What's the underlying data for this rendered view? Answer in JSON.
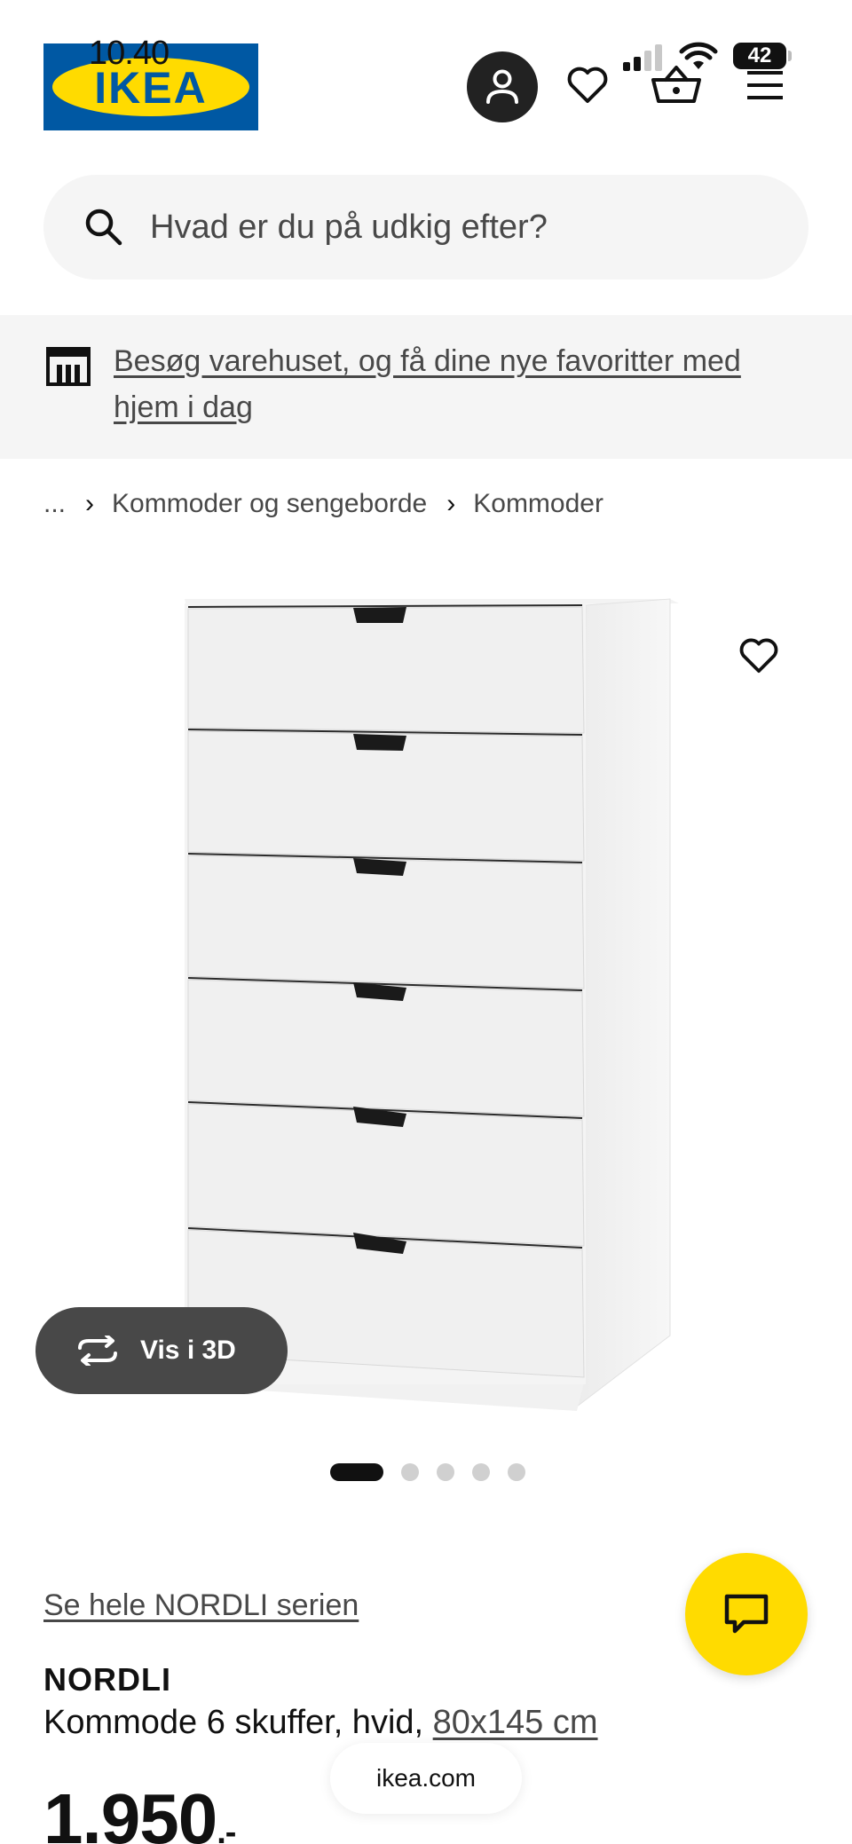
{
  "status_bar": {
    "time": "10.40",
    "battery": "42"
  },
  "header": {
    "logo_text": "IKEA"
  },
  "search": {
    "placeholder": "Hvad er du på udkig efter?"
  },
  "banner": {
    "link_text": "Besøg varehuset, og få dine nye favoritter med hjem i dag"
  },
  "breadcrumb": {
    "ellipsis": "...",
    "items": [
      "Kommoder og sengeborde",
      "Kommoder"
    ]
  },
  "gallery": {
    "view_3d_label": "Vis i 3D",
    "image_count": 5,
    "active_index": 0
  },
  "product": {
    "series_link": "Se hele NORDLI serien",
    "name": "NORDLI",
    "description": "Kommode 6 skuffer, hvid,",
    "size": "80x145 cm",
    "price": "1.950",
    "price_suffix": ".-"
  },
  "browser": {
    "url": "ikea.com"
  },
  "colors": {
    "ikea_blue": "#0058a3",
    "ikea_yellow": "#ffdb00",
    "dark_gray": "#484848"
  }
}
